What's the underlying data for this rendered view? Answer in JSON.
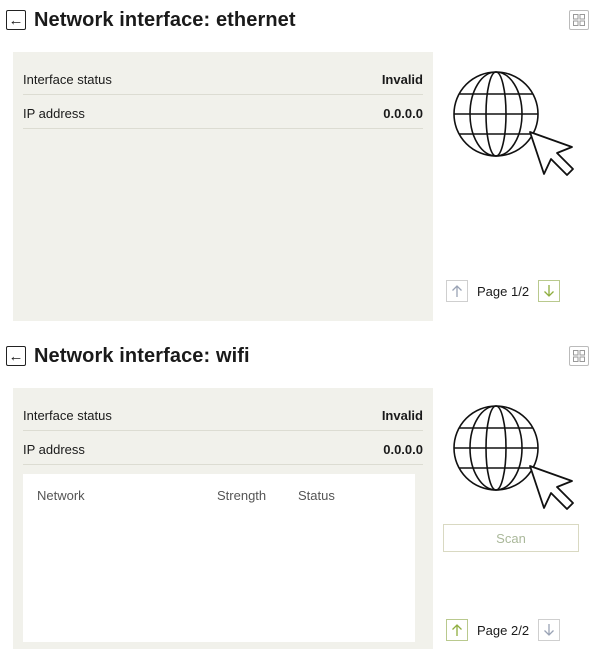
{
  "ethernet": {
    "title": "Network interface: ethernet",
    "interface_status_label": "Interface status",
    "interface_status_value": "Invalid",
    "ip_label": "IP address",
    "ip_value": "0.0.0.0",
    "page_label": "Page 1/2"
  },
  "wifi": {
    "title": "Network interface: wifi",
    "interface_status_label": "Interface status",
    "interface_status_value": "Invalid",
    "ip_label": "IP address",
    "ip_value": "0.0.0.0",
    "columns": [
      "Network",
      "Strength",
      "Status"
    ],
    "scan_label": "Scan",
    "page_label": "Page 2/2"
  },
  "icons": {
    "back": "arrow-left-icon",
    "grid": "grid-icon",
    "globe": "globe-cursor-icon",
    "page_up": "arrow-up-icon",
    "page_down": "arrow-down-icon"
  },
  "colors": {
    "panel_bg": "#f1f1eb",
    "arrow_active": "#8fae3f",
    "arrow_inactive": "#9aa3b5"
  }
}
